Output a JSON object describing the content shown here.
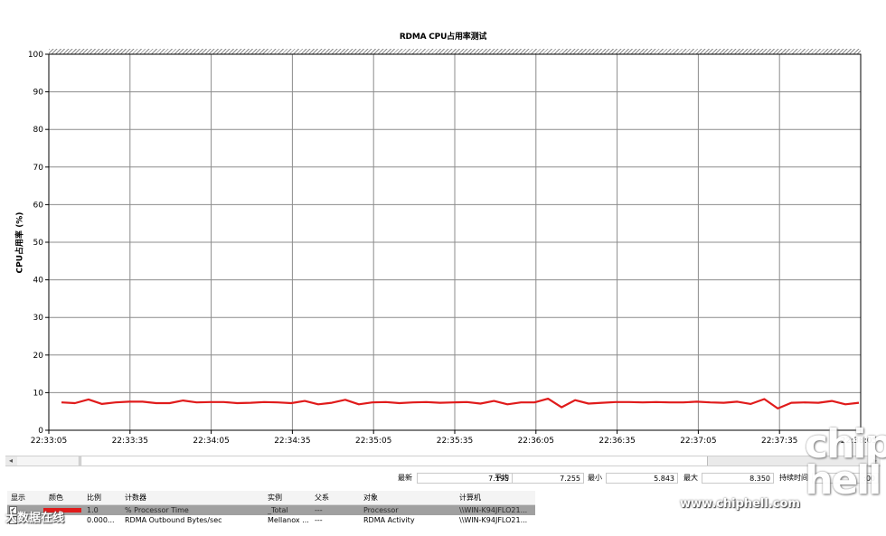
{
  "chart_data": {
    "type": "line",
    "title": "RDMA CPU占用率测试",
    "ylabel": "CPU占用率 (%)",
    "xlabel": "",
    "ylim": [
      0,
      100
    ],
    "yticks": [
      0,
      10,
      20,
      30,
      40,
      50,
      60,
      70,
      80,
      90,
      100
    ],
    "xticks": [
      "22:33:05",
      "22:33:35",
      "22:34:05",
      "22:34:35",
      "22:35:05",
      "22:35:35",
      "22:36:05",
      "22:36:35",
      "22:37:05",
      "22:37:35",
      "22:38:05"
    ],
    "grid": true,
    "series": [
      {
        "color": "#e01b1b",
        "x_start": "22:33:05",
        "x_end": "22:38:05",
        "values": [
          7.4,
          7.2,
          8.2,
          7.0,
          7.4,
          7.6,
          7.6,
          7.2,
          7.2,
          7.9,
          7.4,
          7.5,
          7.5,
          7.2,
          7.3,
          7.5,
          7.4,
          7.2,
          7.8,
          6.9,
          7.3,
          8.1,
          6.9,
          7.4,
          7.5,
          7.2,
          7.4,
          7.5,
          7.3,
          7.4,
          7.5,
          7.1,
          7.8,
          6.9,
          7.4,
          7.4,
          8.4,
          6.1,
          8.0,
          7.1,
          7.3,
          7.5,
          7.5,
          7.4,
          7.5,
          7.4,
          7.4,
          7.6,
          7.4,
          7.3,
          7.6,
          7.0,
          8.3,
          5.8,
          7.3,
          7.4,
          7.3,
          7.8,
          6.9,
          7.3
        ]
      }
    ]
  },
  "stats": {
    "last_label": "最新",
    "last_value": "7.195",
    "avg_label": "平均",
    "avg_value": "7.255",
    "min_label": "最小",
    "min_value": "5.843",
    "max_label": "最大",
    "max_value": "8.350",
    "duration_label": "持续时间",
    "duration_value": ":00"
  },
  "table": {
    "headers": [
      "显示",
      "颜色",
      "比例",
      "计数器",
      "实例",
      "父系",
      "对象",
      "计算机"
    ],
    "rows": [
      {
        "show": true,
        "color": "#e01b1b",
        "scale": "1.0",
        "counter": "% Processor Time",
        "instance": "_Total",
        "parent": "---",
        "object": "Processor",
        "computer": "\\\\WIN-K94JFLO21...",
        "selected": true
      },
      {
        "show": false,
        "color": "",
        "scale": "0.000...",
        "counter": "RDMA Outbound Bytes/sec",
        "instance": "Mellanox ...",
        "parent": "---",
        "object": "RDMA Activity",
        "computer": "\\\\WIN-K94JFLO21...",
        "selected": false
      }
    ]
  },
  "watermark": {
    "logo": "chip hell",
    "url": "www.chiphell.com",
    "small": "大数据在线"
  }
}
